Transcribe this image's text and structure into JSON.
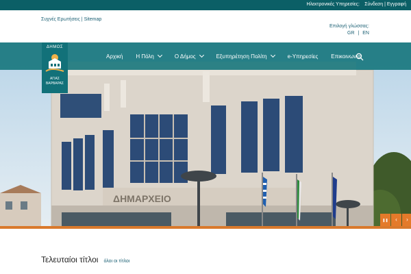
{
  "topbar": {
    "e_services_label": "Ηλεκτρονικές Υπηρεσίες:",
    "login_label": "Σύνδεση",
    "separator": "|",
    "register_label": "Εγγραφή"
  },
  "subheader": {
    "faq_label": "Συχνές Ερωτήσεις",
    "separator": "|",
    "sitemap_label": "Sitemap",
    "language_prompt": "Επιλογή γλώσσας:",
    "languages": [
      "GR",
      "EN"
    ],
    "language_separator": "|"
  },
  "logo": {
    "top_text": "ΔΗΜΟΣ",
    "bottom_text_line1": "ΑΓΙΑΣ",
    "bottom_text_line2": "ΒΑΡΒΑΡΑΣ"
  },
  "nav": {
    "items": [
      {
        "label": "Αρχική",
        "has_dropdown": false
      },
      {
        "label": "Η Πόλη",
        "has_dropdown": true
      },
      {
        "label": "Ο Δήμος",
        "has_dropdown": true
      },
      {
        "label": "Εξυπηρέτηση Πολίτη",
        "has_dropdown": true
      },
      {
        "label": "e-Υπηρεσίες",
        "has_dropdown": false
      },
      {
        "label": "Επικοινωνία",
        "has_dropdown": false
      }
    ],
    "search_icon": "search-icon"
  },
  "hero": {
    "building_sign": "ΔΗΜΑΡΧΕΙΟ"
  },
  "slider": {
    "pause_symbol": "❚❚",
    "prev_symbol": "‹",
    "next_symbol": "›"
  },
  "latest": {
    "title": "Τελευταίοι τίτλοι",
    "all_link": "όλοι οι τίτλοι"
  },
  "colors": {
    "primary": "#0b5f66",
    "accent": "#e47a2a"
  }
}
